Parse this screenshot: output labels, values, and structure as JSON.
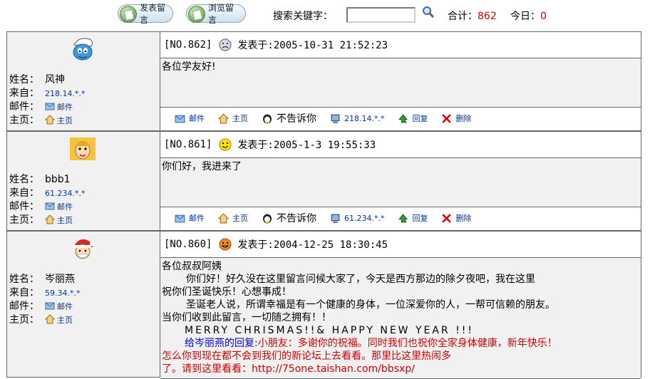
{
  "toolbar": {
    "post_label": "发表留言",
    "browse_label": "浏览留言",
    "search_label": "搜索关键字：",
    "search_value": "",
    "total_label": "合计：",
    "total_value": "862",
    "today_label": "今日：",
    "today_value": "0"
  },
  "fields": {
    "name": "姓名：",
    "from": "来自：",
    "mail": "邮件：",
    "home": "主页：",
    "mail_link": "邮件",
    "home_link": "主页"
  },
  "footer": {
    "mail": "邮件",
    "home": "主页",
    "qq": "不告诉你",
    "reply": "回复",
    "delete": "删除"
  },
  "entries": [
    {
      "no": "[NO.862]",
      "posted": "发表于:2005-10-31 21:52:23",
      "name": "风神",
      "ip": "218.14.*.*",
      "avatar": "smurf-avatar",
      "mood_icon": "sad-face-icon",
      "body_lines": [
        "各位学友好!"
      ]
    },
    {
      "no": "[NO.861]",
      "posted": "发表于:2005-1-3 19:55:33",
      "name": "bbb1",
      "ip": "61.234.*.*",
      "avatar": "girl-avatar",
      "mood_icon": "smile-face-icon",
      "body_lines": [
        "你们好，我进来了"
      ]
    },
    {
      "no": "[NO.860]",
      "posted": "发表于:2004-12-25 18:30:45",
      "name": "岑丽燕",
      "ip": "59.34.*.*",
      "avatar": "santa-avatar",
      "mood_icon": "grin-face-icon",
      "body_lines": [
        "各位叔叔阿姨",
        "你们好！好久没在这里留言问候大家了，今天是西方那边的除夕夜吧，我在这里",
        "祝你们圣诞快乐！心想事成！",
        "圣诞老人说，所谓幸福是有一个健康的身体，一位深爱你的人，一帮可信赖的朋友。",
        "当你们收到此留言，一切随之拥有！！",
        "MERRY  CHRISMAS!!& HAPPY NEW YEAR !!!"
      ],
      "reply_label": "给岑丽燕的回复:",
      "reply_lines": [
        "小朋友：多谢你的祝福。同时我们也祝你全家身体健康，新年快乐！",
        "怎么你到现在都不会到我们的新论坛上去看看。那里比这里热闹多",
        "了。请到这里看看：http://75one.taishan.com/bbsxp/"
      ]
    }
  ]
}
